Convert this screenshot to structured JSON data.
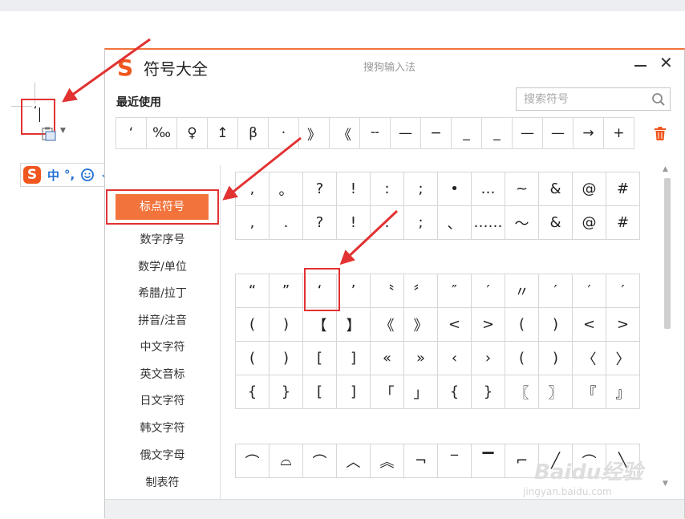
{
  "document": {
    "text_char": "‘"
  },
  "ime_toolbar": {
    "mode_label": "中",
    "punct_label": "°,",
    "logo_letter": "S",
    "icons": [
      "emoji-icon",
      "microphone-icon",
      "keyboard-icon",
      "user-icon",
      "shirt-icon",
      "grid-icon"
    ]
  },
  "dialog": {
    "logo_letter": "S",
    "title": "符号大全",
    "brand": "搜狗输入法",
    "recent_label": "最近使用",
    "search_placeholder": "搜索符号",
    "recent_symbols": [
      "‘",
      "‰",
      "♀",
      "↥",
      "β",
      "·",
      "》",
      "《",
      "╌",
      "—",
      "−",
      "_",
      "_",
      "—",
      "—",
      "→",
      "+"
    ],
    "categories": [
      "标点符号",
      "数字序号",
      "数学/单位",
      "希腊/拉丁",
      "拼音/注音",
      "中文字符",
      "英文音标",
      "日文字符",
      "韩文字符",
      "俄文字母",
      "制表符"
    ],
    "active_category_index": 0,
    "grid_punct": [
      [
        ",",
        "。",
        "?",
        "!",
        ":",
        ";",
        "•",
        "…",
        "~",
        "&",
        "@",
        "#"
      ],
      [
        ",",
        ".",
        "?",
        "!",
        ".",
        ";",
        "、",
        "……",
        "～",
        "&",
        "@",
        "#"
      ]
    ],
    "grid_quotes": [
      [
        "“",
        "”",
        "‘",
        "’",
        "〝",
        "〞",
        "″",
        "′",
        "〃",
        "′",
        "′",
        "′"
      ],
      [
        "(",
        ")",
        "【",
        "】",
        "《",
        "》",
        "<",
        ">",
        "(",
        ")",
        "<",
        ">"
      ],
      [
        "(",
        ")",
        "[",
        "]",
        "«",
        "»",
        "‹",
        "›",
        "(",
        ")",
        "〈",
        "〉"
      ],
      [
        "{",
        "}",
        "[",
        "]",
        "「",
        "」",
        "{",
        "}",
        "〖",
        "〗",
        "『",
        "』"
      ]
    ],
    "grid_marks": [
      [
        "⌒",
        "⌓",
        "⌒",
        "︿",
        "︽",
        "¬",
        "‾",
        "▔",
        "⌐",
        "╱",
        "⌒",
        "╲"
      ]
    ],
    "highlight_cell": {
      "grid": "grid_quotes",
      "row": 0,
      "col": 2
    }
  },
  "watermark": {
    "main": "Baidu经验",
    "sub": "jingyan.baidu.com"
  },
  "colors": {
    "accent": "#f2743c",
    "annotation": "#e23232",
    "ime_blue": "#1f6fd1"
  }
}
